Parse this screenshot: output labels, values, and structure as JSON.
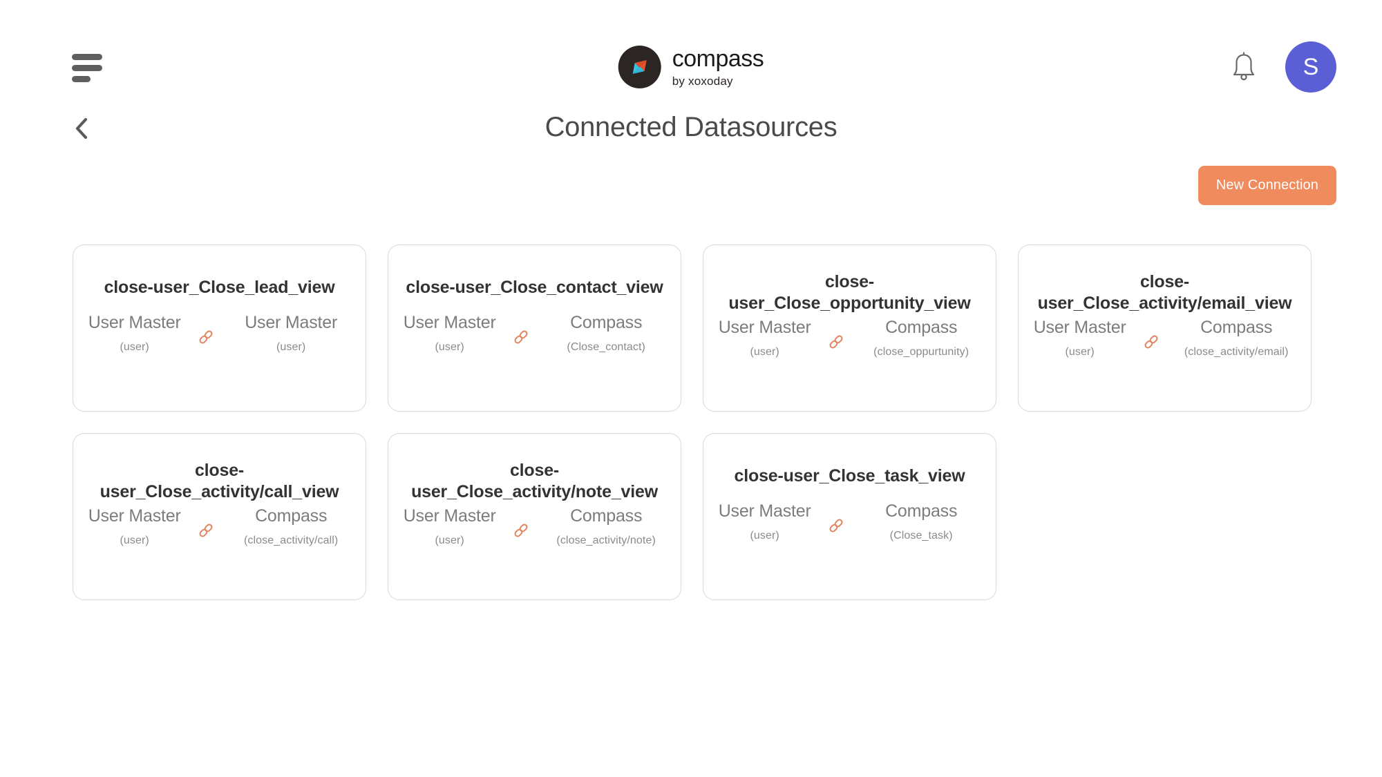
{
  "header": {
    "menu_icon": "hamburger-icon",
    "brand_name": "compass",
    "brand_tagline": "by xoxoday",
    "notification_icon": "bell-icon",
    "avatar_initial": "S",
    "avatar_color": "#5b5fd6"
  },
  "page": {
    "back_icon": "chevron-left-icon",
    "title": "Connected Datasources"
  },
  "toolbar": {
    "new_connection_label": "New Connection",
    "new_connection_color": "#f08b5d"
  },
  "link_icon_color": "#e2825a",
  "cards": [
    {
      "title": "close-user_Close_lead_view",
      "two_line": false,
      "source": {
        "name": "User Master",
        "sub": "(user)"
      },
      "target": {
        "name": "User Master",
        "sub": "(user)"
      },
      "link_icon": "chain-link-icon"
    },
    {
      "title": "close-user_Close_contact_view",
      "two_line": false,
      "source": {
        "name": "User Master",
        "sub": "(user)"
      },
      "target": {
        "name": "Compass",
        "sub": "(Close_contact)"
      },
      "link_icon": "chain-link-icon"
    },
    {
      "title": "close-user_Close_opportunity_view",
      "two_line": true,
      "source": {
        "name": "User Master",
        "sub": "(user)"
      },
      "target": {
        "name": "Compass",
        "sub": "(close_oppurtunity)"
      },
      "link_icon": "chain-link-icon"
    },
    {
      "title": "close-user_Close_activity/email_view",
      "two_line": true,
      "source": {
        "name": "User Master",
        "sub": "(user)"
      },
      "target": {
        "name": "Compass",
        "sub": "(close_activity/email)"
      },
      "link_icon": "chain-link-icon"
    },
    {
      "title": "close-user_Close_activity/call_view",
      "two_line": true,
      "source": {
        "name": "User Master",
        "sub": "(user)"
      },
      "target": {
        "name": "Compass",
        "sub": "(close_activity/call)"
      },
      "link_icon": "chain-link-icon"
    },
    {
      "title": "close-user_Close_activity/note_view",
      "two_line": true,
      "source": {
        "name": "User Master",
        "sub": "(user)"
      },
      "target": {
        "name": "Compass",
        "sub": "(close_activity/note)"
      },
      "link_icon": "chain-link-icon"
    },
    {
      "title": "close-user_Close_task_view",
      "two_line": false,
      "source": {
        "name": "User Master",
        "sub": "(user)"
      },
      "target": {
        "name": "Compass",
        "sub": "(Close_task)"
      },
      "link_icon": "chain-link-icon"
    }
  ]
}
